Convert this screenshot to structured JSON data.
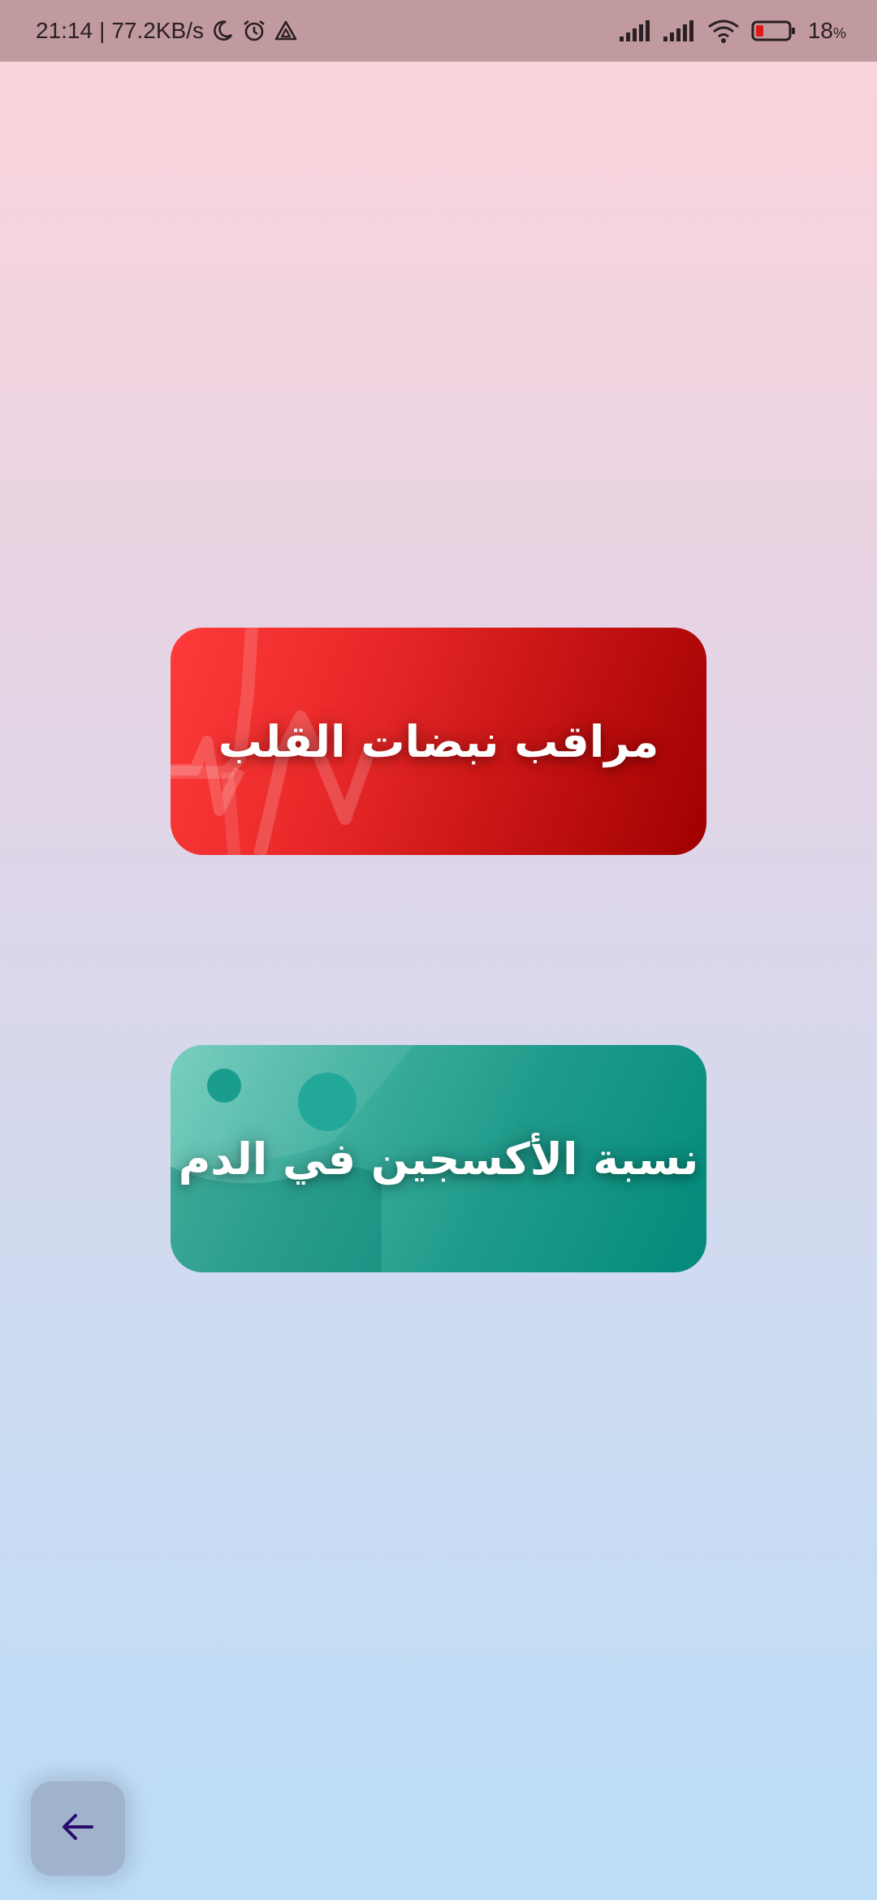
{
  "status_bar": {
    "time": "21:14",
    "separator": "|",
    "network_speed": "77.2KB/s",
    "battery_percent": "18",
    "battery_percent_sign": "%",
    "battery_level": 0.18,
    "icons": [
      "moon-icon",
      "alarm-icon",
      "drive-icon",
      "signal-icon",
      "signal-icon",
      "wifi-icon",
      "battery-icon"
    ]
  },
  "cards": {
    "heart_rate": {
      "label": "مراقب نبضات القلب",
      "color_from": "#ff3b3b",
      "color_to": "#a00000"
    },
    "oxygen": {
      "label": "نسبة الأكسجين في الدم",
      "color_from": "#6ecbb9",
      "color_to": "#028a7a"
    }
  },
  "back_button": {
    "icon": "arrow-left-icon",
    "icon_color": "#2a0b6e"
  }
}
